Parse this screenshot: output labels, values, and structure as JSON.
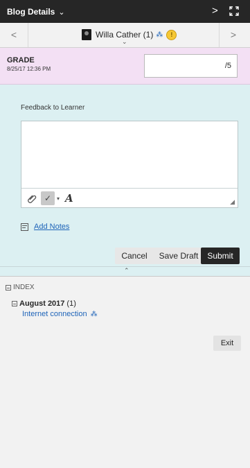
{
  "header": {
    "title": "Blog Details",
    "next_glyph": ">"
  },
  "user_nav": {
    "prev_glyph": "<",
    "next_glyph": ">",
    "name": "Willa Cather (1)"
  },
  "grade": {
    "label": "GRADE",
    "date": "8/25/17 12:36 PM",
    "value_display": "/5"
  },
  "feedback": {
    "label": "Feedback to Learner",
    "text": ""
  },
  "notes": {
    "link_label": "Add Notes"
  },
  "actions": {
    "cancel": "Cancel",
    "save_draft": "Save Draft",
    "submit": "Submit"
  },
  "index": {
    "title": "INDEX",
    "month": "August 2017",
    "month_count": "(1)",
    "entry": "Internet connection"
  },
  "exit": {
    "label": "Exit"
  },
  "colors": {
    "header_bg": "#262626",
    "grade_bg": "#f3e0f4",
    "feedback_bg": "#dcf0f2",
    "link": "#1d63b8",
    "submit_bg": "#262626"
  }
}
